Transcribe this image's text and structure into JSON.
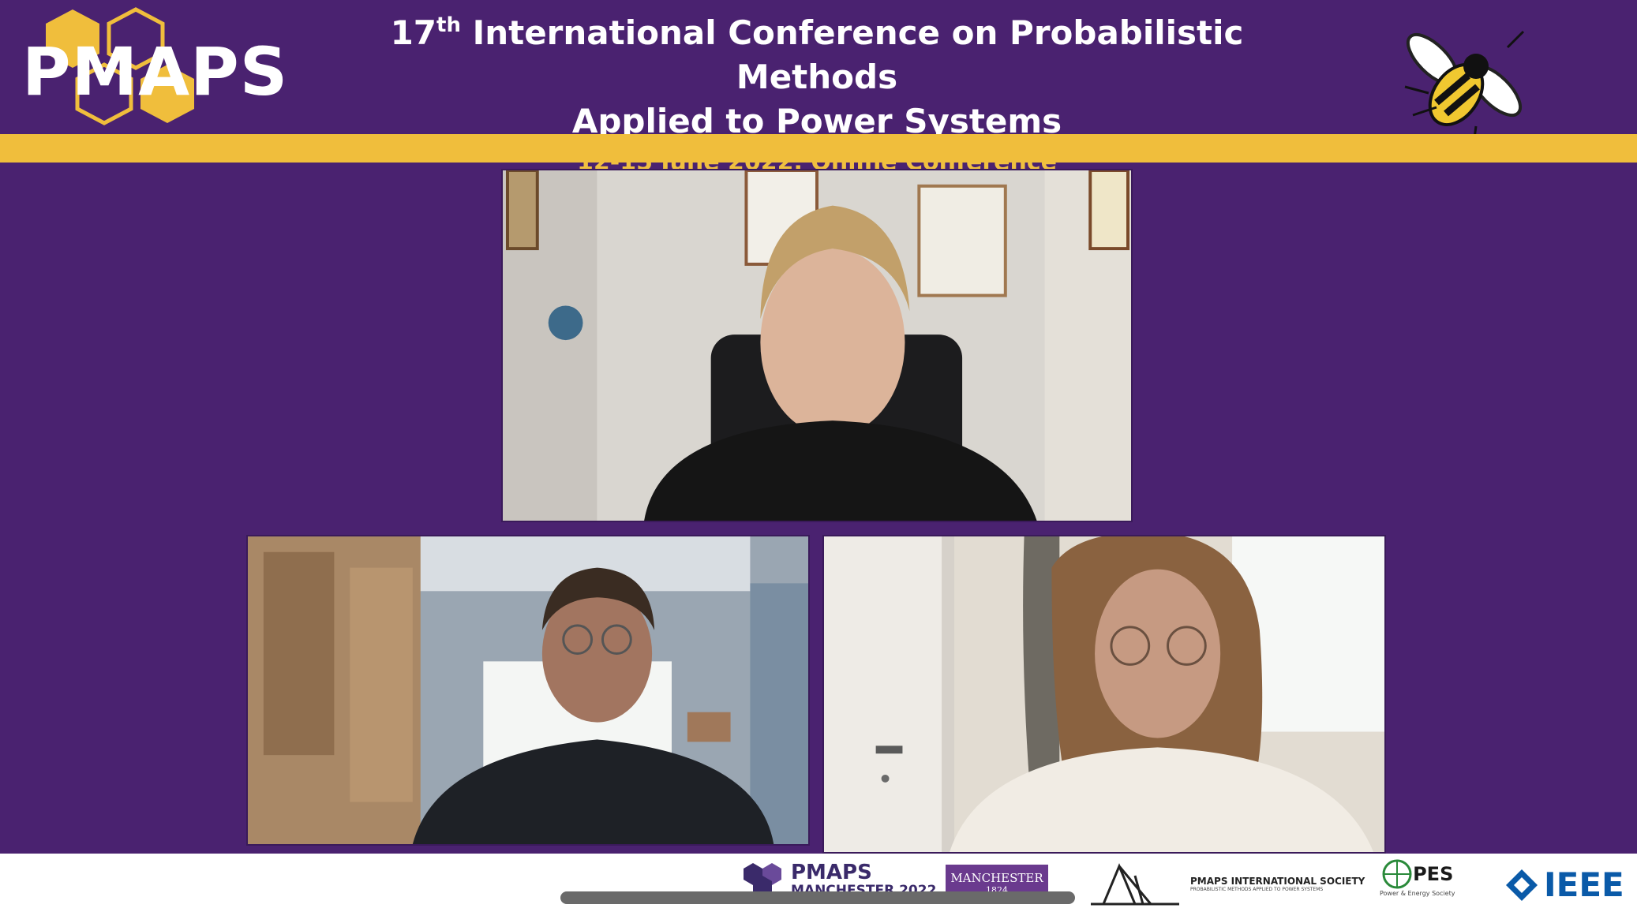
{
  "header": {
    "logo_text": "PMAPS",
    "title_prefix": "17",
    "title_superscript": "th",
    "title_line1_rest": " International Conference on Probabilistic Methods",
    "title_line2": "Applied to Power Systems",
    "subtitle": "12-15 June 2022, Online Conference"
  },
  "participants": [
    {
      "tile": "top",
      "description": "woman-speaker"
    },
    {
      "tile": "bottom-left",
      "description": "man-with-glasses"
    },
    {
      "tile": "bottom-right",
      "description": "woman-with-glasses"
    }
  ],
  "footer": {
    "pmaps_name": "PMAPS",
    "pmaps_sub": "MANCHESTER 2022",
    "manchester_line1": "MANCHESTER",
    "manchester_line2": "1824",
    "society_name": "PMAPS INTERNATIONAL SOCIETY",
    "society_tagline": "PROBABILISTIC METHODS APPLIED TO POWER SYSTEMS",
    "pes_name": "PES",
    "pes_tagline": "Power & Energy Society",
    "ieee_name": "IEEE"
  },
  "colors": {
    "background": "#4a2270",
    "accent_gold": "#f0be3c",
    "subtitle_gold": "#f0c040"
  }
}
